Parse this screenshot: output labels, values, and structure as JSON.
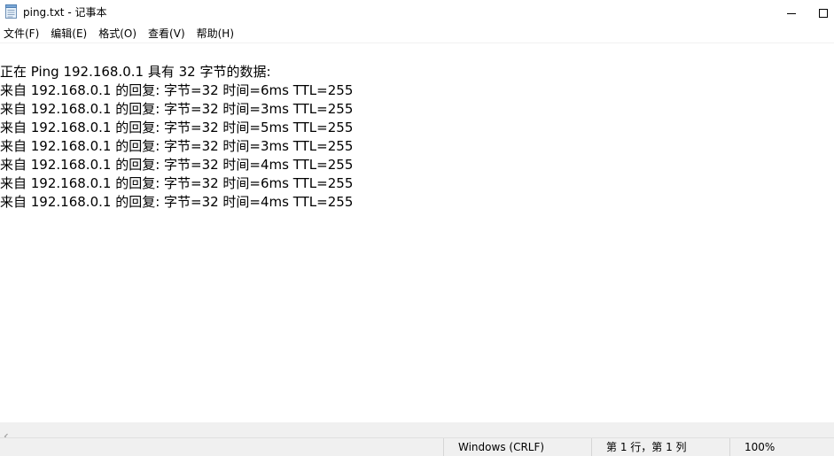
{
  "window": {
    "title": "ping.txt - 记事本",
    "app_icon": "notepad-icon",
    "minimize_icon": "minimize-icon",
    "maximize_icon": "maximize-icon"
  },
  "menu": {
    "items": [
      {
        "label": "文件(F)"
      },
      {
        "label": "编辑(E)"
      },
      {
        "label": "格式(O)"
      },
      {
        "label": "查看(V)"
      },
      {
        "label": "帮助(H)"
      }
    ]
  },
  "document": {
    "lines": [
      "",
      "正在 Ping 192.168.0.1 具有 32 字节的数据:",
      "来自 192.168.0.1 的回复: 字节=32 时间=6ms TTL=255",
      "来自 192.168.0.1 的回复: 字节=32 时间=3ms TTL=255",
      "来自 192.168.0.1 的回复: 字节=32 时间=5ms TTL=255",
      "来自 192.168.0.1 的回复: 字节=32 时间=3ms TTL=255",
      "来自 192.168.0.1 的回复: 字节=32 时间=4ms TTL=255",
      "来自 192.168.0.1 的回复: 字节=32 时间=6ms TTL=255",
      "来自 192.168.0.1 的回复: 字节=32 时间=4ms TTL=255"
    ]
  },
  "scrollbar": {
    "left_arrow_icon": "chevron-left-icon"
  },
  "status": {
    "encoding": "Windows (CRLF)",
    "position": "第 1 行，第 1 列",
    "zoom": "100%"
  }
}
